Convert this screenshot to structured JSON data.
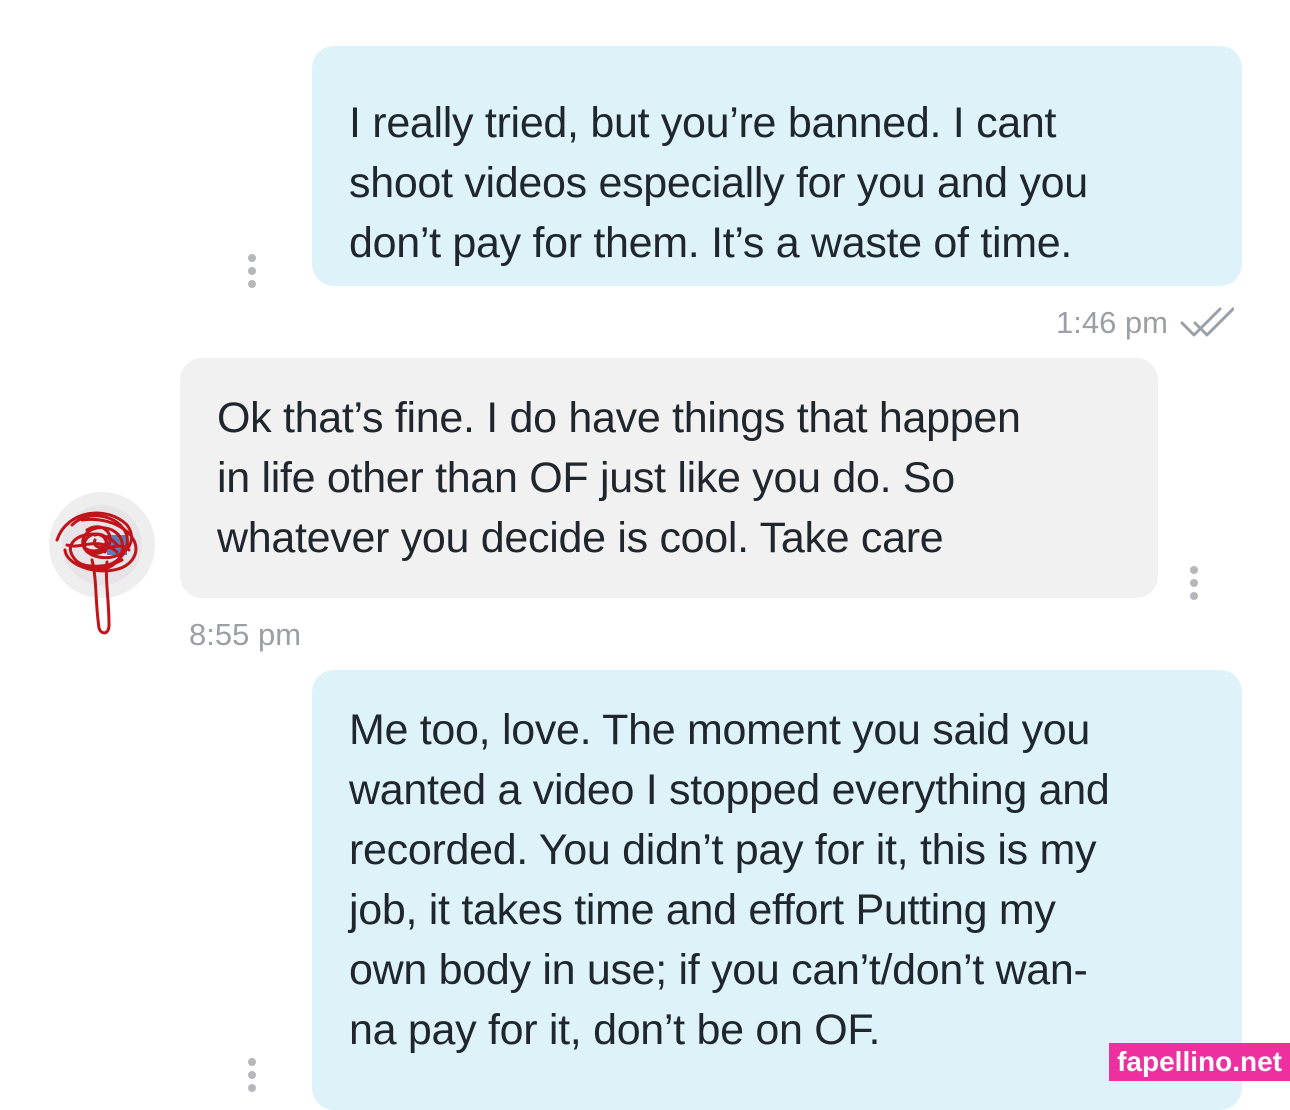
{
  "messages": [
    {
      "direction": "outgoing",
      "lines": [
        "I really tried, but you’re banned. I cant",
        "shoot videos especially for you and you",
        "don’t pay for them. It’s a waste of time."
      ],
      "time": "1:46 pm",
      "status_icon": "double-check-icon"
    },
    {
      "direction": "incoming",
      "lines": [
        "Ok that’s fine. I do have things that happen",
        "in life other than OF just like you do. So",
        "whatever you decide is cool. Take care"
      ],
      "time": "8:55 pm"
    },
    {
      "direction": "outgoing",
      "lines": [
        "Me too, love. The moment you said you",
        "wanted a video I stopped everything and",
        "recorded. You didn’t pay for it, this is my",
        "job, it takes time and effort Putting my",
        "own body in use; if you can’t/don’t wan-",
        "na pay for it, don’t be on OF."
      ]
    }
  ],
  "watermark": "fapellino.net",
  "icons": {
    "message_menu": "more-vertical-icon",
    "avatar": "redacted-avatar"
  },
  "colors": {
    "outgoing_bubble": "#ddf3f9",
    "incoming_bubble": "#f1f1f2",
    "watermark_bg": "#ee2fa0",
    "redaction": "#c0141a"
  }
}
